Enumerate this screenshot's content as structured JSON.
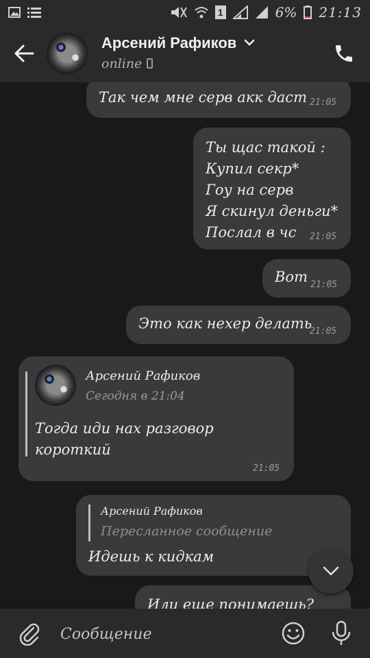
{
  "status_bar": {
    "battery": "6%",
    "time": "21:13",
    "sim": "1"
  },
  "header": {
    "name": "Арсений Рафиков",
    "status": "online"
  },
  "messages": [
    {
      "lines": [
        "Так чем мне серв акк даст"
      ],
      "time": "21:05"
    },
    {
      "lines": [
        "Ты щас такой :",
        "Купил секр*",
        "Гоу на серв",
        "Я скинул деньги*",
        "Послал в чс"
      ],
      "time": "21:05"
    },
    {
      "lines": [
        "Вот"
      ],
      "time": "21:05"
    },
    {
      "lines": [
        "Это как нехер делать"
      ],
      "time": "21:05"
    }
  ],
  "reply_message": {
    "quote_author": "Арсений Рафиков",
    "quote_time": "Сегодня в 21:04",
    "lines": [
      "Тогда иди нах разговор",
      "короткий"
    ],
    "time": "21:05"
  },
  "forwarded_message": {
    "author": "Арсений Рафиков",
    "label": "Пересланное сообщение",
    "text": "Идешь к кидкам"
  },
  "partial_message": {
    "text": "Или еще понимаешь?"
  },
  "composer": {
    "placeholder": "Сообщение"
  },
  "colors": {
    "background": "#19191a",
    "bar": "#2a2a2c",
    "bubble": "#3a3a3d"
  }
}
